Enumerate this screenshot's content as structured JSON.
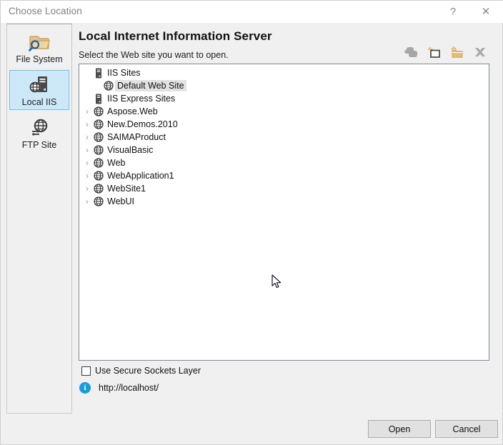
{
  "window": {
    "title": "Choose Location",
    "help_glyph": "?",
    "close_glyph": "✕"
  },
  "sidebar": {
    "items": [
      {
        "label": "File System",
        "icon": "folder-search-icon",
        "selected": false
      },
      {
        "label": "Local IIS",
        "icon": "server-globe-icon",
        "selected": true
      },
      {
        "label": "FTP Site",
        "icon": "globe-transfer-icon",
        "selected": false
      }
    ]
  },
  "content": {
    "heading": "Local Internet Information Server",
    "subheading": "Select the Web site you want to open."
  },
  "toolbar": {
    "buttons": [
      {
        "name": "copy-web-site-button",
        "icon": "copy-icon"
      },
      {
        "name": "new-web-application-button",
        "icon": "new-application-icon"
      },
      {
        "name": "create-new-virtual-directory-button",
        "icon": "new-folder-icon"
      },
      {
        "name": "delete-button",
        "icon": "delete-x-icon"
      }
    ]
  },
  "tree": {
    "rows": [
      {
        "label": "IIS Sites",
        "icon": "server-icon",
        "chevron": false,
        "indent": 0,
        "selected": false
      },
      {
        "label": "Default Web Site",
        "icon": "globe-icon",
        "chevron": false,
        "indent": 1,
        "selected": true
      },
      {
        "label": "IIS Express Sites",
        "icon": "server-icon",
        "chevron": false,
        "indent": 0,
        "selected": false
      },
      {
        "label": "Aspose.Web",
        "icon": "globe-icon",
        "chevron": true,
        "indent": 0,
        "selected": false
      },
      {
        "label": "New.Demos.2010",
        "icon": "globe-icon",
        "chevron": true,
        "indent": 0,
        "selected": false
      },
      {
        "label": "SAIMAProduct",
        "icon": "globe-icon",
        "chevron": true,
        "indent": 0,
        "selected": false
      },
      {
        "label": "VisualBasic",
        "icon": "globe-icon",
        "chevron": true,
        "indent": 0,
        "selected": false
      },
      {
        "label": "Web",
        "icon": "globe-icon",
        "chevron": true,
        "indent": 0,
        "selected": false
      },
      {
        "label": "WebApplication1",
        "icon": "globe-icon",
        "chevron": true,
        "indent": 0,
        "selected": false
      },
      {
        "label": "WebSite1",
        "icon": "globe-icon",
        "chevron": true,
        "indent": 0,
        "selected": false
      },
      {
        "label": "WebUI",
        "icon": "globe-icon",
        "chevron": true,
        "indent": 0,
        "selected": false
      }
    ],
    "chevron_glyph": "›"
  },
  "options": {
    "ssl_label": "Use Secure Sockets Layer",
    "ssl_checked": false
  },
  "status": {
    "info_glyph": "i",
    "url": "http://localhost/"
  },
  "footer": {
    "open_label": "Open",
    "cancel_label": "Cancel"
  },
  "colors": {
    "dialog_bg": "#f0f0f0",
    "selection_blue": "#cde8f8",
    "selection_blue_border": "#7bbde8",
    "tree_selection_gray": "#e2e2e2",
    "info_blue": "#1b9bd8",
    "folder_tan": "#e0bc7c",
    "icon_dark": "#3c3c3c"
  }
}
